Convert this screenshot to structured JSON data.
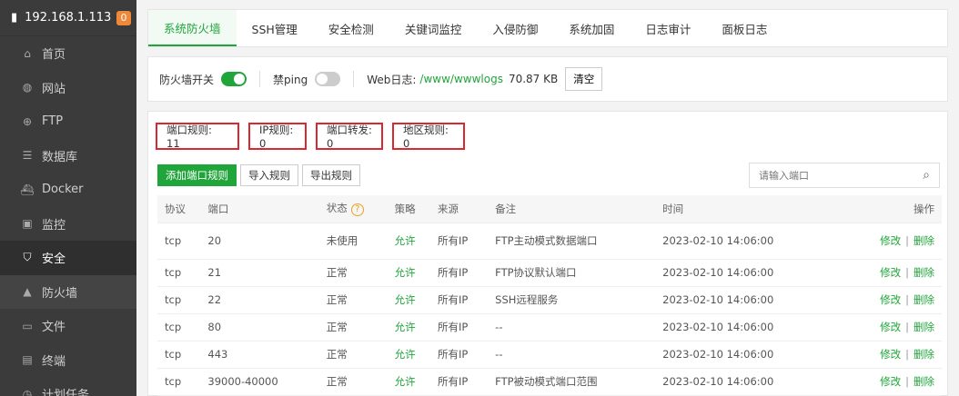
{
  "sidebar": {
    "server_ip": "192.168.1.113",
    "badge": "0",
    "items": [
      {
        "label": "首页",
        "icon": "home-icon"
      },
      {
        "label": "网站",
        "icon": "globe-icon"
      },
      {
        "label": "FTP",
        "icon": "ftp-icon"
      },
      {
        "label": "数据库",
        "icon": "database-icon"
      },
      {
        "label": "Docker",
        "icon": "docker-icon"
      },
      {
        "label": "监控",
        "icon": "monitor-icon"
      },
      {
        "label": "安全",
        "icon": "shield-icon"
      },
      {
        "label": "防火墙",
        "icon": "firewall-icon"
      },
      {
        "label": "文件",
        "icon": "folder-icon"
      },
      {
        "label": "终端",
        "icon": "terminal-icon"
      },
      {
        "label": "计划任务",
        "icon": "clock-icon"
      }
    ]
  },
  "tabs": [
    "系统防火墙",
    "SSH管理",
    "安全检测",
    "关键词监控",
    "入侵防御",
    "系统加固",
    "日志审计",
    "面板日志"
  ],
  "toolbar": {
    "firewall_label": "防火墙开关",
    "ping_label": "禁ping",
    "weblog_label": "Web日志:",
    "weblog_path": "/www/wwwlogs",
    "weblog_size": "70.87 KB",
    "clear_label": "清空"
  },
  "stats": {
    "port_rules": "端口规则: 11",
    "ip_rules": "IP规则: 0",
    "port_forward": "端口转发: 0",
    "region_rules": "地区规则: 0"
  },
  "actions": {
    "add": "添加端口规则",
    "import": "导入规则",
    "export": "导出规则"
  },
  "search": {
    "placeholder": "请输入端口"
  },
  "table": {
    "headers": [
      "协议",
      "端口",
      "状态",
      "策略",
      "来源",
      "备注",
      "时间",
      "操作"
    ],
    "edit": "修改",
    "delete": "删除",
    "rows": [
      [
        "tcp",
        "20",
        "未使用",
        "允许",
        "所有IP",
        "FTP主动模式数据端口",
        "2023-02-10 14:06:00"
      ],
      [
        "tcp",
        "21",
        "正常",
        "允许",
        "所有IP",
        "FTP协议默认端口",
        "2023-02-10 14:06:00"
      ],
      [
        "tcp",
        "22",
        "正常",
        "允许",
        "所有IP",
        "SSH远程服务",
        "2023-02-10 14:06:00"
      ],
      [
        "tcp",
        "80",
        "正常",
        "允许",
        "所有IP",
        "--",
        "2023-02-10 14:06:00"
      ],
      [
        "tcp",
        "443",
        "正常",
        "允许",
        "所有IP",
        "--",
        "2023-02-10 14:06:00"
      ],
      [
        "tcp",
        "39000-40000",
        "正常",
        "允许",
        "所有IP",
        "FTP被动模式端口范围",
        "2023-02-10 14:06:00"
      ]
    ]
  },
  "colors": {
    "accent": "#20a53a",
    "highlight_box": "#d9282f",
    "sidebar_bg": "#3b3b3b"
  }
}
